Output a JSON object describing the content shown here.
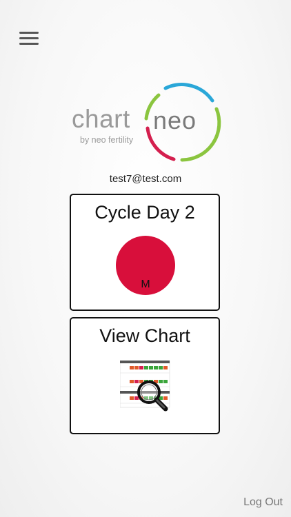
{
  "header": {
    "menu_icon": "hamburger-menu-icon"
  },
  "logo": {
    "chart_word": "chart",
    "neo_word": "neo",
    "tagline": "by neo fertility",
    "ring_colors": [
      "#2aa7d8",
      "#8bc53f",
      "#d41f4e"
    ]
  },
  "user": {
    "email": "test7@test.com"
  },
  "cycle_card": {
    "title": "Cycle Day 2",
    "marker_letter": "M",
    "marker_color": "#d80f3b"
  },
  "view_chart_card": {
    "title": "View Chart",
    "icon": "chart-magnifier-icon"
  },
  "footer": {
    "logout_label": "Log Out"
  }
}
